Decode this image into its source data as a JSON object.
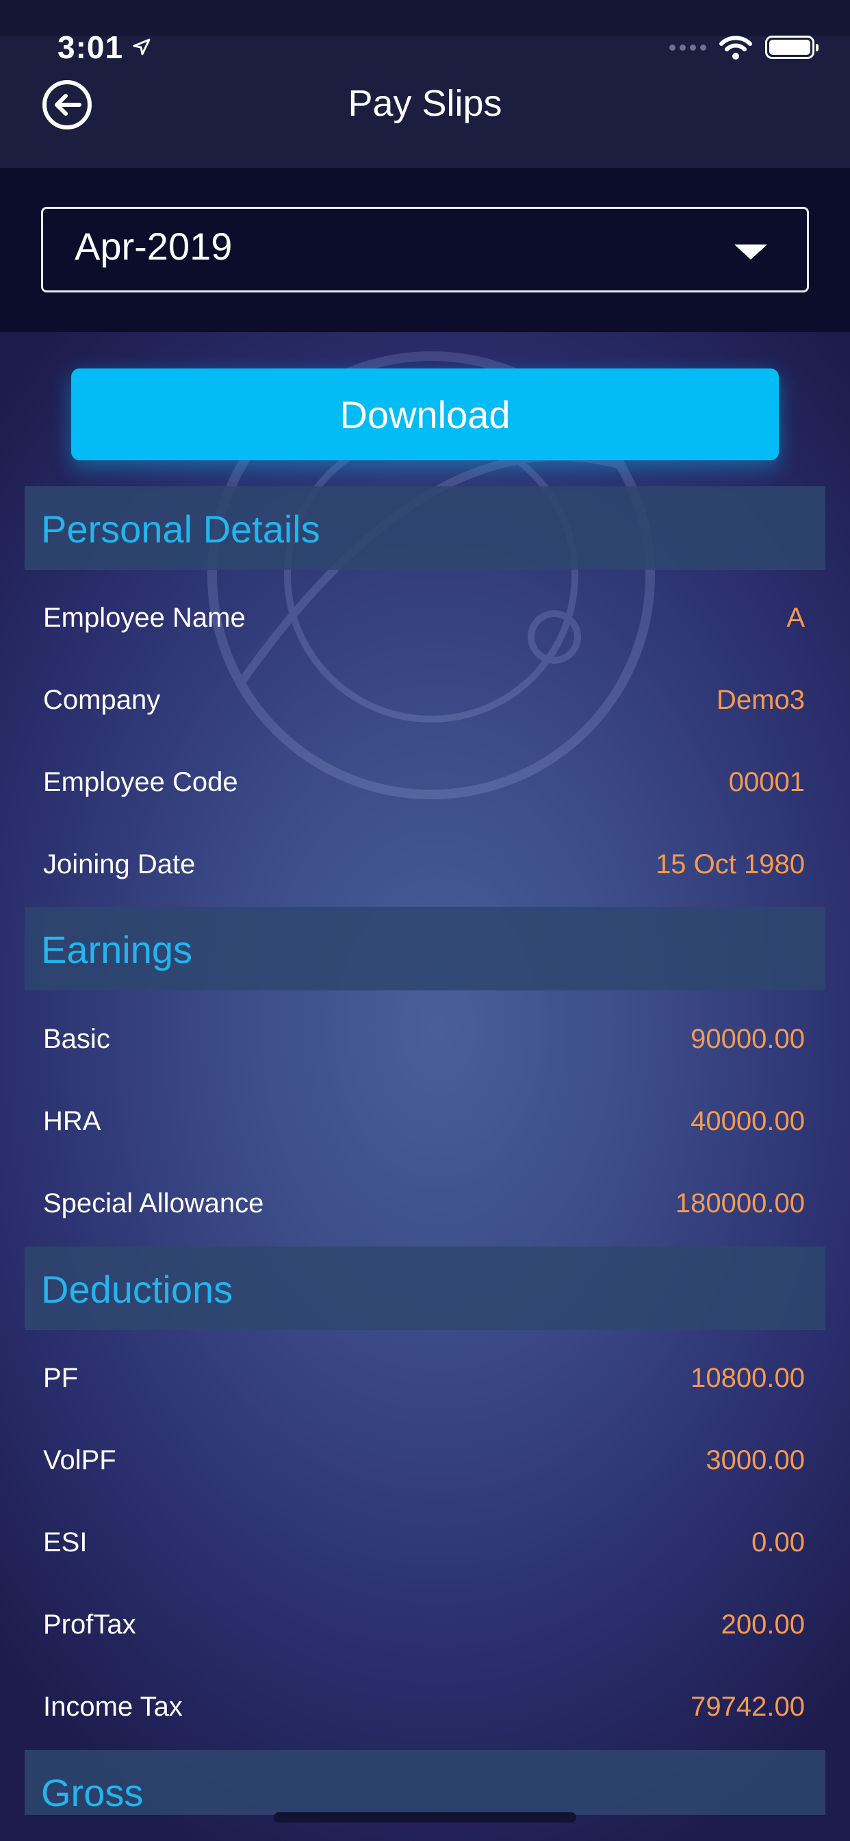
{
  "status_bar": {
    "time": "3:01"
  },
  "header": {
    "title": "Pay Slips"
  },
  "month_selector": {
    "value": "Apr-2019"
  },
  "actions": {
    "download_label": "Download"
  },
  "sections": {
    "personal": {
      "title": "Personal Details",
      "rows": [
        {
          "label": "Employee Name",
          "value": "A"
        },
        {
          "label": "Company",
          "value": "Demo3"
        },
        {
          "label": "Employee Code",
          "value": "00001"
        },
        {
          "label": "Joining Date",
          "value": "15 Oct 1980"
        }
      ]
    },
    "earnings": {
      "title": "Earnings",
      "rows": [
        {
          "label": "Basic",
          "value": "90000.00"
        },
        {
          "label": "HRA",
          "value": "40000.00"
        },
        {
          "label": "Special Allowance",
          "value": "180000.00"
        }
      ]
    },
    "deductions": {
      "title": "Deductions",
      "rows": [
        {
          "label": "PF",
          "value": "10800.00"
        },
        {
          "label": "VolPF",
          "value": "3000.00"
        },
        {
          "label": "ESI",
          "value": "0.00"
        },
        {
          "label": "ProfTax",
          "value": "200.00"
        },
        {
          "label": "Income Tax",
          "value": "79742.00"
        }
      ]
    },
    "gross": {
      "title": "Gross"
    }
  },
  "colors": {
    "accent": "#03bcf6",
    "section_title": "#22b5f0",
    "value": "#f59a50",
    "header_bg": "#1b1e3f"
  }
}
